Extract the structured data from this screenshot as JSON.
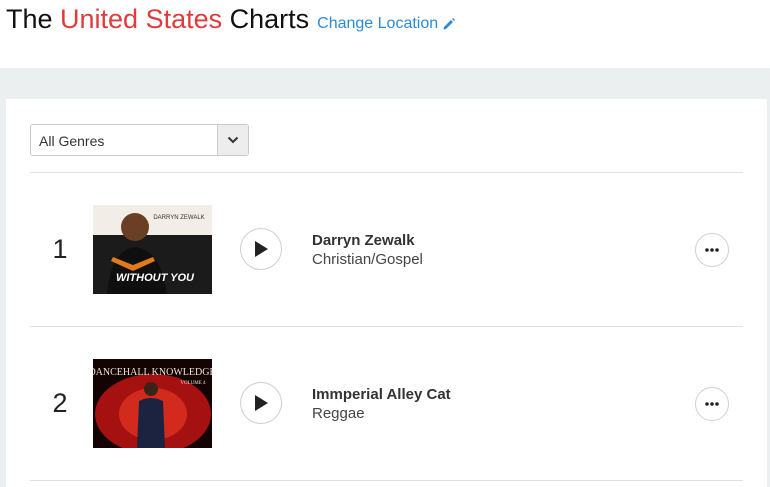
{
  "header": {
    "title_prefix": "The ",
    "location": "United States",
    "title_suffix": " Charts",
    "change_location": "Change Location"
  },
  "filter": {
    "selected": "All Genres"
  },
  "chart_rows": [
    {
      "rank": "1",
      "artist": "Darryn Zewalk",
      "genre": "Christian/Gospel",
      "art_top": "DARRYN ZEWALK",
      "art_bottom": "WITHOUT YOU"
    },
    {
      "rank": "2",
      "artist": "Immperial Alley Cat",
      "genre": "Reggae",
      "art_top": "DANCEHALL KNOWLEDGE",
      "art_bottom": "VOLUME 4"
    }
  ],
  "colors": {
    "accent_red": "#e23b3b",
    "link_blue": "#2c8bd4",
    "band_gray": "#eceff0"
  }
}
